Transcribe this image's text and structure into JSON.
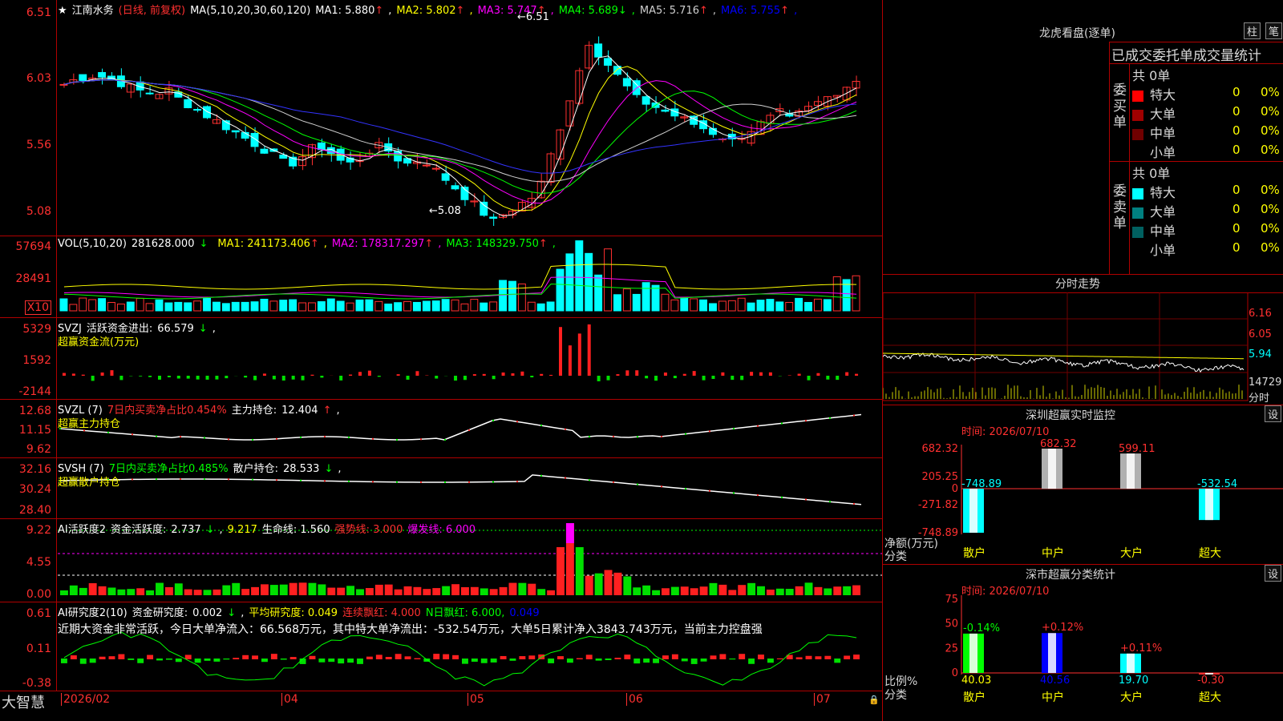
{
  "stock": {
    "name": "江南水务",
    "period": "(日线, 前复权)",
    "ma_label": "MA(5,10,20,30,60,120)",
    "ma": [
      {
        "label": "MA1:",
        "value": "5.880",
        "arrow": "↑",
        "color": "#ffffff"
      },
      {
        "label": "MA2:",
        "value": "5.802",
        "arrow": "↑",
        "color": "#ffff00"
      },
      {
        "label": "MA3:",
        "value": "5.747",
        "arrow": "↑",
        "color": "#ff00ff"
      },
      {
        "label": "MA4:",
        "value": "5.689",
        "arrow": "↓",
        "color": "#00ff00"
      },
      {
        "label": "MA5:",
        "value": "5.716",
        "arrow": "↑",
        "color": "#d0d0d0"
      },
      {
        "label": "MA6:",
        "value": "5.755",
        "arrow": "↑",
        "color": "#0000ff"
      }
    ],
    "high_mark": "6.51",
    "low_mark": "5.08"
  },
  "price_axis": [
    "6.51",
    "6.03",
    "5.56",
    "5.08"
  ],
  "vol": {
    "label": "VOL(5,10,20)",
    "value": "281628.000",
    "ma": [
      {
        "label": "MA1:",
        "value": "241173.406",
        "arrow": "↑",
        "color": "#ffff00"
      },
      {
        "label": "MA2:",
        "value": "178317.297",
        "arrow": "↑",
        "color": "#ff00ff"
      },
      {
        "label": "MA3:",
        "value": "148329.750",
        "arrow": "↑",
        "color": "#00ff00"
      }
    ],
    "axis": [
      "57694",
      "28491"
    ],
    "unit": "X10"
  },
  "svzj": {
    "label": "SVZJ",
    "name": "活跃资金进出:",
    "value": "66.579",
    "arrow": "↓",
    "sub": "超赢资金流(万元)",
    "axis": [
      "5329",
      "1592",
      "-2144"
    ]
  },
  "svzl": {
    "label": "SVZL (7)",
    "ratio": "7日内买卖净占比0.454%",
    "name": "主力持仓:",
    "value": "12.404",
    "sub": "超赢主力持仓",
    "axis": [
      "12.68",
      "11.15",
      "9.62"
    ]
  },
  "svsh": {
    "label": "SVSH (7)",
    "ratio": "7日内买卖净占比0.485%",
    "name": "散户持仓:",
    "value": "28.533",
    "sub": "超赢散户持仓",
    "axis": [
      "32.16",
      "30.24",
      "28.40"
    ]
  },
  "ai_active": {
    "label": "AI活跃度2",
    "name": "资金活跃度:",
    "value": "2.737",
    "v2": "9.217",
    "life": "生命线: 1.560",
    "strong": "强势线: 3.000",
    "burst": "爆发线: 6.000",
    "axis": [
      "9.22",
      "4.55",
      "0.00"
    ]
  },
  "ai_research": {
    "label": "AI研究度2(10)",
    "name": "资金研究度:",
    "value": "0.002",
    "avg": "平均研究度: 0.049",
    "cont": "连续飘红: 4.000",
    "n": "N日飘红: 6.000,",
    "last": "0.049",
    "text": "近期大资金非常活跃，今日大单净流入：66.568万元，其中特大单净流出：-532.54万元，大单5日累计净入3843.743万元，当前主力控盘强",
    "axis": [
      "0.61",
      "0.11",
      "-0.38"
    ]
  },
  "xaxis": [
    "2026/02",
    "04",
    "05",
    "06",
    "07"
  ],
  "brand": "大智慧",
  "right": {
    "title": "龙虎看盘(逐单)",
    "btn1": "柱",
    "btn2": "笔",
    "table_title": "已成交委托单成交量统计",
    "buy_label": "委买单",
    "sell_label": "委卖单",
    "buy_total": "共 0单",
    "sell_total": "共 0单",
    "buy_rows": [
      {
        "name": "特大",
        "count": "0",
        "pct": "0%",
        "color": "#ff0000"
      },
      {
        "name": "大单",
        "count": "0",
        "pct": "0%",
        "color": "#a00000"
      },
      {
        "name": "中单",
        "count": "0",
        "pct": "0%",
        "color": "#700000"
      },
      {
        "name": "小单",
        "count": "0",
        "pct": "0%",
        "color": "#000000"
      }
    ],
    "sell_rows": [
      {
        "name": "特大",
        "count": "0",
        "pct": "0%",
        "color": "#00ffff"
      },
      {
        "name": "大单",
        "count": "0",
        "pct": "0%",
        "color": "#008080"
      },
      {
        "name": "中单",
        "count": "0",
        "pct": "0%",
        "color": "#006060"
      },
      {
        "name": "小单",
        "count": "0",
        "pct": "0%",
        "color": "#000000"
      }
    ],
    "intraday_title": "分时走势",
    "intraday_axis": [
      "6.16",
      "6.05",
      "5.94",
      "14729"
    ],
    "intraday_unit": "分时",
    "sz_title": "深圳超赢实时监控",
    "sz_time": "时间: 2026/07/10",
    "sz_axis": [
      "682.32",
      "205.25",
      "0",
      "-271.82",
      "-748.89"
    ],
    "sz_ylabel": "净额(万元)",
    "sz_xlabel": "分类",
    "set": "设",
    "stat_title": "深市超赢分类统计",
    "stat_time": "时间: 2026/07/10",
    "stat_axis": [
      "75",
      "50",
      "25",
      "0"
    ],
    "stat_ylabel": "比例%",
    "stat_xlabel": "分类",
    "categories": [
      "散户",
      "中户",
      "大户",
      "超大"
    ]
  },
  "chart_data": [
    {
      "type": "bar",
      "title": "深圳超赢实时监控",
      "categories": [
        "散户",
        "中户",
        "大户",
        "超大"
      ],
      "values": [
        -748.89,
        682.32,
        599.11,
        -532.54
      ],
      "value_labels": [
        "-748.89",
        "682.32",
        "599.11",
        "-532.54"
      ],
      "ylabel": "净额(万元)",
      "ylim": [
        -748.89,
        682.32
      ]
    },
    {
      "type": "bar",
      "title": "深市超赢分类统计",
      "categories": [
        "散户",
        "中户",
        "大户",
        "超大"
      ],
      "values": [
        40.03,
        40.56,
        19.7,
        -0.3
      ],
      "changes": [
        "-0.14%",
        "+0.12%",
        "+0.11%",
        ""
      ],
      "value_labels": [
        "40.03",
        "40.56",
        "19.70",
        "-0.30"
      ],
      "ylabel": "比例%",
      "ylim": [
        0,
        75
      ]
    }
  ]
}
